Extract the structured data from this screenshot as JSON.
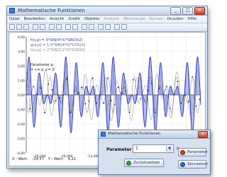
{
  "window": {
    "title": "Mathematische Funktionen",
    "minimize": "_",
    "maximize": "□",
    "close": "×"
  },
  "menu": {
    "items": [
      {
        "label": "Datei",
        "disabled": false
      },
      {
        "label": "Bearbeiten",
        "disabled": false
      },
      {
        "label": "Ansicht",
        "disabled": false
      },
      {
        "label": "Grafik",
        "disabled": false
      },
      {
        "label": "Objekte",
        "disabled": false
      },
      {
        "label": "Analyse",
        "disabled": true
      },
      {
        "label": "Werkzeuge",
        "disabled": true
      },
      {
        "label": "Kurven",
        "disabled": true
      },
      {
        "label": "Drucken",
        "disabled": false
      },
      {
        "label": "Hilfe",
        "disabled": false
      }
    ]
  },
  "legend": [
    {
      "text": "f(x,p) = 3*SIN(4*X)*SIN(X/2)",
      "color": "#2b3cc8"
    },
    {
      "text": "g(x,p) = 1.5*SIN(4*X)*COS(X)",
      "color": "#5a5aa8"
    },
    {
      "text": "h(x,p) = 2*SIN(3.2*X)*COS(X)",
      "color": "#888888"
    }
  ],
  "parameter": {
    "heading": "Parameter p",
    "range": "0 <= p <= 5"
  },
  "axes": {
    "y_ticks": [
      "4,00",
      "3,00",
      "2,00",
      "1,00",
      "0,00",
      "-1,00",
      "-2,00",
      "-3,00",
      "-4,00"
    ],
    "x_ticks": [
      "-20,000",
      "-16,000",
      "-12,000",
      "-8,000",
      "4,00"
    ]
  },
  "status": {
    "x_label": "X - Wert:",
    "x_value": "-24,57",
    "y_label": "Y - Wert:",
    "y_value": "4,21"
  },
  "dialog": {
    "title": "Mathematische Funktionen",
    "param_label": "Parameter P:",
    "select_value": "1",
    "value_text": "0",
    "button_zurueck": "Zurücksetzen",
    "button_parameter": "Parameter",
    "button_simulation": "Simulation"
  },
  "chart_data": {
    "type": "line",
    "xlim": [
      -22,
      4
    ],
    "ylim": [
      -4.5,
      4.5
    ],
    "series": [
      {
        "name": "f",
        "color": "#2b3cc8",
        "style": "hatched fill",
        "formula": "3*sin(4x)*sin(x/2)"
      },
      {
        "name": "g",
        "color": "#333333",
        "style": "dotted with markers",
        "formula": "1.5*sin(4x)*cos(x)"
      },
      {
        "name": "h",
        "color": "#999999",
        "style": "thin line",
        "formula": "2*sin(3.2x)*cos(x)"
      }
    ]
  }
}
